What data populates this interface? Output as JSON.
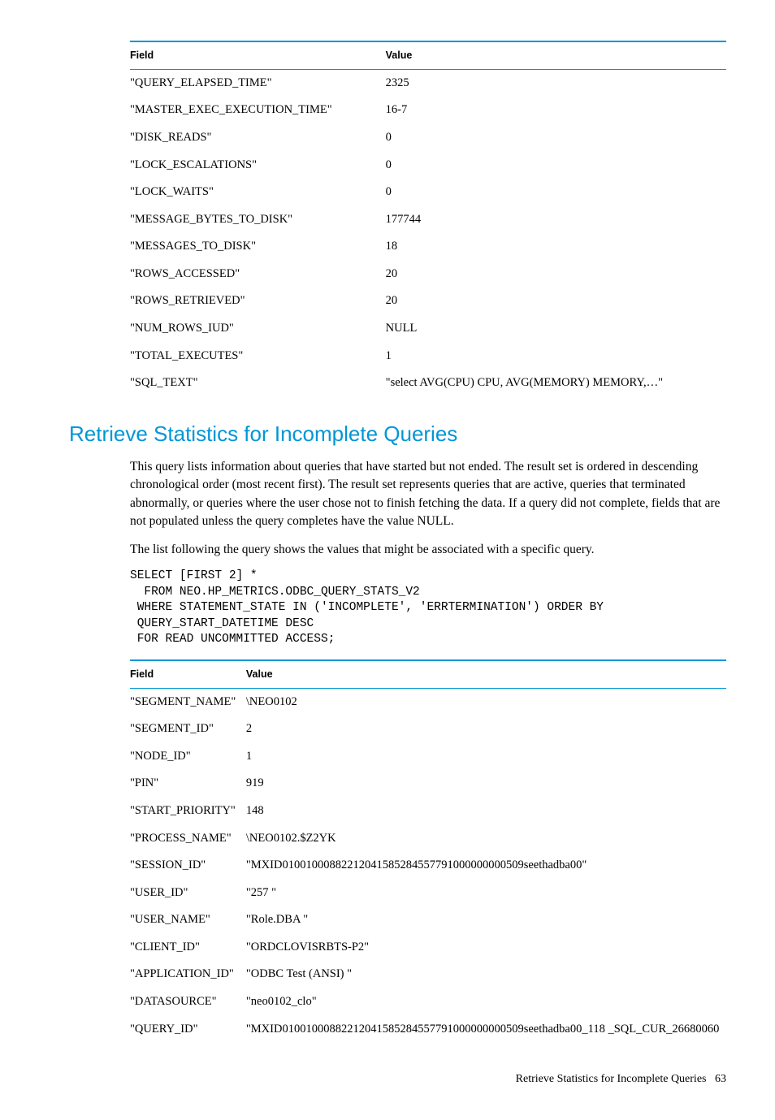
{
  "table1": {
    "headers": {
      "field": "Field",
      "value": "Value"
    },
    "rows": [
      {
        "field": "\"QUERY_ELAPSED_TIME\"",
        "value": "2325"
      },
      {
        "field": "\"MASTER_EXEC_EXECUTION_TIME\"",
        "value": "16-7"
      },
      {
        "field": "\"DISK_READS\"",
        "value": "0"
      },
      {
        "field": "\"LOCK_ESCALATIONS\"",
        "value": "0"
      },
      {
        "field": "\"LOCK_WAITS\"",
        "value": "0"
      },
      {
        "field": "\"MESSAGE_BYTES_TO_DISK\"",
        "value": "177744"
      },
      {
        "field": "\"MESSAGES_TO_DISK\"",
        "value": "18"
      },
      {
        "field": "\"ROWS_ACCESSED\"",
        "value": "20"
      },
      {
        "field": "\"ROWS_RETRIEVED\"",
        "value": "20"
      },
      {
        "field": "\"NUM_ROWS_IUD\"",
        "value": "NULL"
      },
      {
        "field": "\"TOTAL_EXECUTES\"",
        "value": "1"
      },
      {
        "field": "\"SQL_TEXT\"",
        "value": "\"select AVG(CPU) CPU, AVG(MEMORY) MEMORY,…\""
      }
    ]
  },
  "heading": "Retrieve Statistics for Incomplete Queries",
  "para1": "This query lists information about queries that have started but not ended. The result set is ordered in descending chronological order (most recent first). The result set represents queries that are active, queries that terminated abnormally, or queries where the user chose not to finish fetching the data. If a query did not complete, fields that are not populated unless the query completes have the value NULL.",
  "para2": "The list following the query shows the values that might be associated with a specific query.",
  "code": "SELECT [FIRST 2] *\n  FROM NEO.HP_METRICS.ODBC_QUERY_STATS_V2\n WHERE STATEMENT_STATE IN ('INCOMPLETE', 'ERRTERMINATION') ORDER BY\n QUERY_START_DATETIME DESC\n FOR READ UNCOMMITTED ACCESS;",
  "table2": {
    "headers": {
      "field": "Field",
      "value": "Value"
    },
    "rows": [
      {
        "field": "\"SEGMENT_NAME\"",
        "value": "\\NEO0102"
      },
      {
        "field": "\"SEGMENT_ID\"",
        "value": "2"
      },
      {
        "field": "\"NODE_ID\"",
        "value": "1"
      },
      {
        "field": "\"PIN\"",
        "value": "919"
      },
      {
        "field": "\"START_PRIORITY\"",
        "value": "148"
      },
      {
        "field": "\"PROCESS_NAME\"",
        "value": "\\NEO0102.$Z2YK"
      },
      {
        "field": "\"SESSION_ID\"",
        "value": "\"MXID01001000882212041585284557791000000000509seethadba00\""
      },
      {
        "field": "\"USER_ID\"",
        "value": "\"257 \""
      },
      {
        "field": "\"USER_NAME\"",
        "value": "\"Role.DBA \""
      },
      {
        "field": "\"CLIENT_ID\"",
        "value": "\"ORDCLOVISRBTS-P2\""
      },
      {
        "field": "\"APPLICATION_ID\"",
        "value": "\"ODBC Test (ANSI) \""
      },
      {
        "field": "\"DATASOURCE\"",
        "value": "\"neo0102_clo\""
      },
      {
        "field": "\"QUERY_ID\"",
        "value": "\"MXID01001000882212041585284557791000000000509seethadba00_118 _SQL_CUR_26680060"
      }
    ]
  },
  "footer": {
    "text": "Retrieve Statistics for Incomplete Queries",
    "page": "63"
  }
}
